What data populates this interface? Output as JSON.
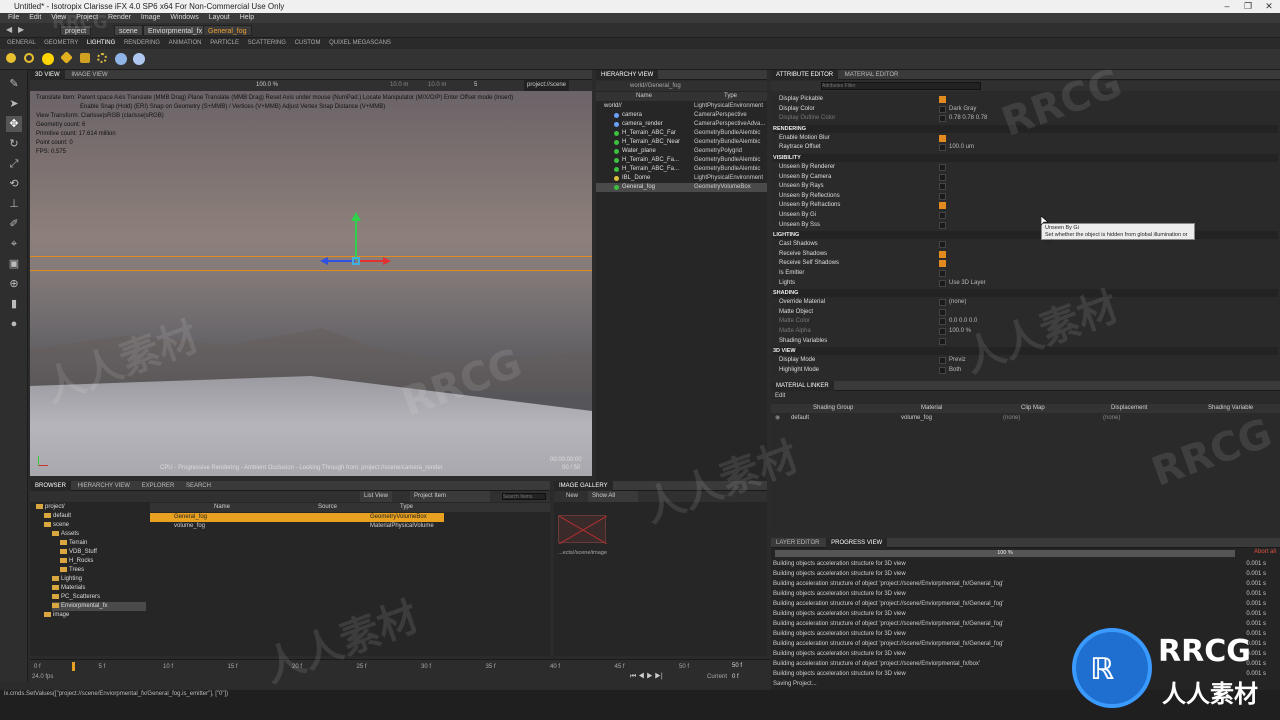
{
  "window": {
    "title": "Untitled* - Isotropix Clarisse iFX 4.0 SP6 x64 For Non-Commercial Use Only",
    "menus": [
      "File",
      "Edit",
      "View",
      "Project",
      "Render",
      "Image",
      "Windows",
      "Layout",
      "Help"
    ],
    "controls": [
      "–",
      "❐",
      "✕"
    ]
  },
  "path_bar": {
    "items": [
      "project",
      "scene",
      "Enviorpmental_fx",
      "General_fog"
    ]
  },
  "shelf_tabs": [
    "GENERAL",
    "GEOMETRY",
    "LIGHTING",
    "RENDERING",
    "ANIMATION",
    "PARTICLE",
    "SCATTERING",
    "CUSTOM",
    "QUIXEL MEGASCANS"
  ],
  "shelf_active": "LIGHTING",
  "viewport": {
    "tabs": [
      "3D VIEW",
      "IMAGE VIEW"
    ],
    "zoom": "100.0 %",
    "field1": "10.0 m",
    "field2": "10.0 m",
    "frame_field": "5",
    "camera_path": "project://scene",
    "overlay": [
      "Translate Item: Parent space  Axis Translate (MMB Drag)  Plane Translate (MMB Drag)  Reset Axis under mouse (NumPad.)  Locate Manipulator (M/X/O/P)  Enter Offset mode (Insert)",
      "Enable Snap (Hold) (ERI)  Snap on Geometry (S+MMB) / Vertices (V+MMB)  Adjust Vertex Snap Distance (V+MMB)",
      "View Transform: Clarisse|sRGB (clarisse|sRGB)",
      "Geometry count: 6",
      "Primitive count: 17.614 million",
      "Point count: 0",
      "FPS: 0.575"
    ],
    "status": "CPU - Progressive Rendering - Ambient Occlusion - Looking Through from: project://scene/camera_render",
    "time": "00:00:00:00",
    "samples": "00 / 50"
  },
  "hierarchy": {
    "tabs": [
      "HIERARCHY VIEW"
    ],
    "path": "world//General_fog",
    "columns": [
      "Name",
      "Type"
    ],
    "rows": [
      {
        "name": "world//",
        "type": "LightPhysicalEnvironment",
        "color": "#9a9a9a"
      },
      {
        "name": "camera",
        "type": "CameraPerspective",
        "color": "#6aa0ff"
      },
      {
        "name": "camera_render",
        "type": "CameraPerspectiveAdva...",
        "color": "#6aa0ff"
      },
      {
        "name": "H_Terrain_ABC_Far",
        "type": "GeometryBundleAlembic",
        "color": "#3cc040"
      },
      {
        "name": "H_Terrain_ABC_Near",
        "type": "GeometryBundleAlembic",
        "color": "#3cc040"
      },
      {
        "name": "Water_plane",
        "type": "GeometryPolygrid",
        "color": "#3cc040"
      },
      {
        "name": "H_Terrain_ABC_Fa...",
        "type": "GeometryBundleAlembic",
        "color": "#3cc040"
      },
      {
        "name": "H_Terrain_ABC_Fa...",
        "type": "GeometryBundleAlembic",
        "color": "#3cc040"
      },
      {
        "name": "IBL_Dome",
        "type": "LightPhysicalEnvironment",
        "color": "#e0c040"
      },
      {
        "name": "General_fog",
        "type": "GeometryVolumeBox",
        "color": "#3cc040"
      }
    ],
    "selected_index": 9
  },
  "attributes": {
    "tabs": [
      "ATTRIBUTE EDITOR",
      "MATERIAL EDITOR"
    ],
    "filter_placeholder": "Attributes Filter",
    "rows_top": [
      {
        "label": "Display Pickable",
        "check": true,
        "value": ""
      },
      {
        "label": "Display Color",
        "check": false,
        "value": "Dark Gray"
      },
      {
        "label": "Display Outline Color",
        "check": false,
        "value": "0.78          0.78          0.78",
        "dim": true
      }
    ],
    "sections": [
      {
        "title": "RENDERING",
        "rows": [
          {
            "label": "Enable Motion Blur",
            "check": true,
            "value": ""
          },
          {
            "label": "Raytrace Offset",
            "check": false,
            "value": "100.0 um"
          }
        ]
      },
      {
        "title": "VISIBILITY",
        "rows": [
          {
            "label": "Unseen By Renderer",
            "check": false,
            "value": ""
          },
          {
            "label": "Unseen By Camera",
            "check": false,
            "value": ""
          },
          {
            "label": "Unseen By Rays",
            "check": false,
            "value": ""
          },
          {
            "label": "Unseen By Reflections",
            "check": false,
            "value": ""
          },
          {
            "label": "Unseen By Refractions",
            "check": true,
            "value": ""
          },
          {
            "label": "Unseen By Gi",
            "check": false,
            "value": ""
          },
          {
            "label": "Unseen By Sss",
            "check": false,
            "value": ""
          }
        ]
      },
      {
        "title": "LIGHTING",
        "rows": [
          {
            "label": "Cast Shadows",
            "check": false,
            "value": ""
          },
          {
            "label": "Receive Shadows",
            "check": true,
            "value": ""
          },
          {
            "label": "Receive Self Shadows",
            "check": true,
            "value": ""
          },
          {
            "label": "Is Emitter",
            "check": false,
            "value": ""
          },
          {
            "label": "Lights",
            "check": false,
            "value": "Use 3D Layer"
          }
        ]
      },
      {
        "title": "SHADING",
        "rows": [
          {
            "label": "Override Material",
            "check": false,
            "value": "(none)"
          },
          {
            "label": "Matte Object",
            "check": false,
            "value": ""
          },
          {
            "label": "Matte Color",
            "check": false,
            "value": "0.0          0.0          0.0",
            "dim": true
          },
          {
            "label": "Matte Alpha",
            "check": false,
            "value": "100.0 %",
            "dim": true
          },
          {
            "label": "Shading Variables",
            "check": false,
            "value": ""
          }
        ]
      },
      {
        "title": "3D VIEW",
        "rows": [
          {
            "label": "Display Mode",
            "check": false,
            "value": "Previz"
          },
          {
            "label": "Highlight Mode",
            "check": false,
            "value": "Both"
          }
        ]
      }
    ],
    "tooltip_title": "Unseen By Gi",
    "tooltip_text": "Set whether the object is hidden from global illumination or not."
  },
  "material_linker": {
    "tab": "MATERIAL LINKER",
    "edit": "Edit",
    "columns": [
      "Shading Group",
      "Material",
      "Clip Map",
      "Displacement",
      "Shading Variable"
    ],
    "row": {
      "group": "default",
      "material": "volume_fog",
      "clip": "(none)",
      "disp": "(none)"
    }
  },
  "progress": {
    "tabs": [
      "LAYER EDITOR",
      "PROGRESS VIEW"
    ],
    "percent": "100 %",
    "abort": "Abort all",
    "lines": [
      {
        "text": "Building objects acceleration structure for 3D view",
        "t": "0.001 s"
      },
      {
        "text": "Building objects acceleration structure for 3D view",
        "t": "0.001 s"
      },
      {
        "text": "Building acceleration structure of object 'project://scene/Enviorpmental_fx/General_fog'",
        "t": "0.001 s"
      },
      {
        "text": "Building objects acceleration structure for 3D view",
        "t": "0.001 s"
      },
      {
        "text": "Building acceleration structure of object 'project://scene/Enviorpmental_fx/General_fog'",
        "t": "0.001 s"
      },
      {
        "text": "Building objects acceleration structure for 3D view",
        "t": "0.001 s"
      },
      {
        "text": "Building acceleration structure of object 'project://scene/Enviorpmental_fx/General_fog'",
        "t": "0.001 s"
      },
      {
        "text": "Building objects acceleration structure for 3D view",
        "t": "0.001 s"
      },
      {
        "text": "Building acceleration structure of object 'project://scene/Enviorpmental_fx/General_fog'",
        "t": "0.001 s"
      },
      {
        "text": "Building objects acceleration structure for 3D view",
        "t": "0.001 s"
      },
      {
        "text": "Building acceleration structure of object 'project://scene/Enviorpmental_fx/box'",
        "t": "0.001 s"
      },
      {
        "text": "Building objects acceleration structure for 3D view",
        "t": "0.001 s"
      },
      {
        "text": "Saving Project...",
        "t": ""
      }
    ]
  },
  "browser": {
    "tabs": [
      "BROWSER",
      "HIERARCHY VIEW",
      "EXPLORER",
      "SEARCH"
    ],
    "view_mode": "List View",
    "filter": "Project Item",
    "search_placeholder": "Search Items",
    "tree": [
      "project/",
      "default",
      "scene",
      "Assets",
      "Terrain",
      "VDB_Stuff",
      "H_Rocks",
      "Trees",
      "Lighting",
      "Materials",
      "PC_Scatterers",
      "Enviorpmental_fx",
      "image"
    ],
    "columns": [
      "Name",
      "Source",
      "Type"
    ],
    "items": [
      {
        "name": "General_fog",
        "source": "",
        "type": "GeometryVolumeBox",
        "selected": true
      },
      {
        "name": "volume_fog",
        "source": "",
        "type": "MaterialPhysicalVolume",
        "selected": false
      }
    ]
  },
  "gallery": {
    "tab": "IMAGE GALLERY",
    "new_label": "New",
    "show": "Show All",
    "caption": "...ects//scene/image"
  },
  "timeline": {
    "ticks": [
      "0 f",
      "5 f",
      "10 f",
      "15 f",
      "20 f",
      "25 f",
      "30 f",
      "35 f",
      "40 f",
      "45 f",
      "50 f"
    ],
    "fps": "24.0 fps",
    "current_label": "Current",
    "current": "0 f",
    "end": "50 f"
  },
  "status_bar": {
    "command": "ix.cmds.SetValues([\"project://scene/Enviorpmental_fx/General_fog.is_emitter\"], [\"0\"])"
  },
  "watermark": {
    "rrcg": "RRCG",
    "cn": "人人素材"
  },
  "colors": {
    "accent": "#e08a20",
    "selection": "#e8a020"
  }
}
